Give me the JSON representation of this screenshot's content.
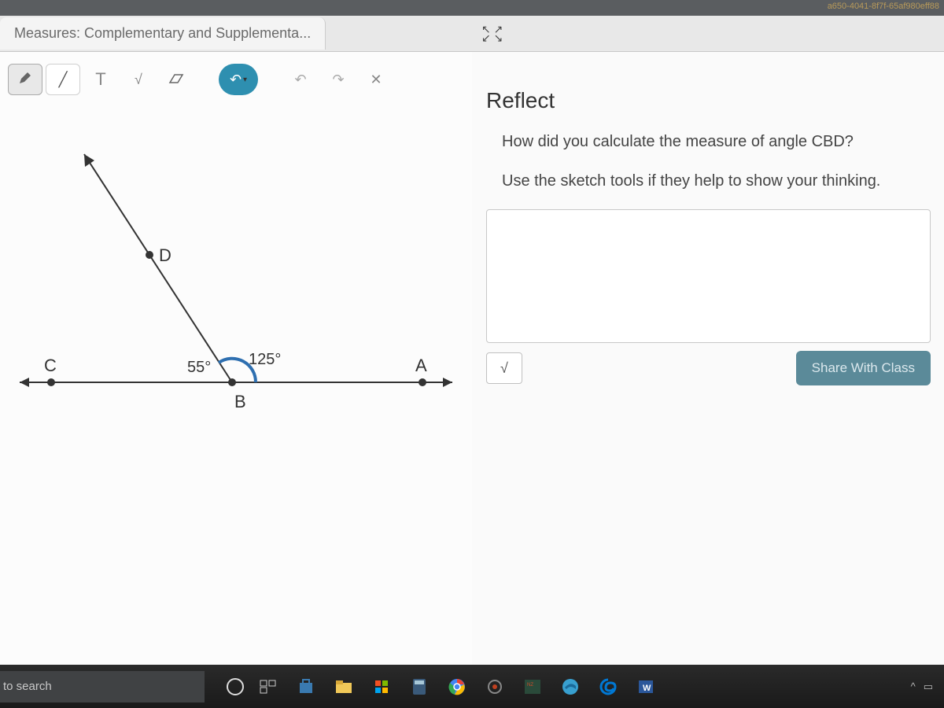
{
  "browser": {
    "url_fragment": "a650-4041-8f7f-65af980eff88",
    "tab_title": "Measures: Complementary and Supplementa..."
  },
  "toolbar": {
    "pen": "✎",
    "line_tool": "╱",
    "text_tool": "T",
    "math_tool": "√",
    "eraser": "⌫",
    "color_tool": "↶",
    "chev": "▾",
    "undo": "↶",
    "redo": "↷",
    "close": "✕"
  },
  "diagram": {
    "point_c": "C",
    "point_d": "D",
    "point_b": "B",
    "point_a": "A",
    "angle_cbd": "55°",
    "angle_dba": "125°"
  },
  "reflect": {
    "expand_icon_top": "↖ ↗",
    "expand_icon_bot": "↙ ↘",
    "title": "Reflect",
    "q1": "How did you calculate the measure of angle CBD?",
    "q2": "Use the sketch tools if they help to show your thinking.",
    "math_btn": "√",
    "share_btn": "Share With Class"
  },
  "taskbar": {
    "search_placeholder": "to search",
    "task_view": "⊞",
    "chevron": "^",
    "battery": "▭"
  }
}
